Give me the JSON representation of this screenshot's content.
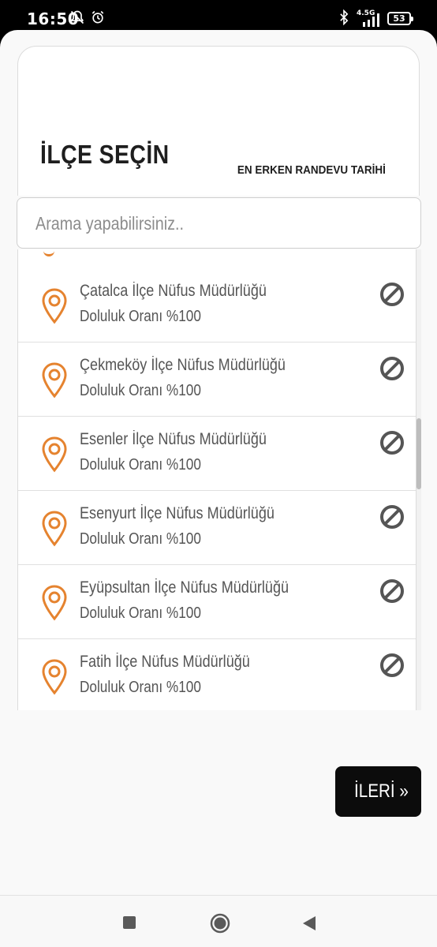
{
  "status_bar": {
    "time": "16:50",
    "network": "4.5G",
    "battery": "53",
    "icons": [
      "notifications-off-icon",
      "alarm-icon",
      "bluetooth-icon",
      "signal-icon",
      "battery-icon"
    ]
  },
  "header": {
    "title": "İLÇE SEÇİN",
    "earliest_label": "EN ERKEN RANDEVU TARİHİ"
  },
  "search": {
    "placeholder": "Arama yapabilirsiniz.."
  },
  "offices": [
    {
      "name": "Çatalca İlçe Nüfus Müdürlüğü",
      "occupancy": "Doluluk Oranı %100",
      "icon": "location-pin-icon",
      "status_icon": "unavailable-icon"
    },
    {
      "name": "Çekmeköy İlçe Nüfus Müdürlüğü",
      "occupancy": "Doluluk Oranı %100",
      "icon": "location-pin-icon",
      "status_icon": "unavailable-icon"
    },
    {
      "name": "Esenler İlçe Nüfus Müdürlüğü",
      "occupancy": "Doluluk Oranı %100",
      "icon": "location-pin-icon",
      "status_icon": "unavailable-icon"
    },
    {
      "name": "Esenyurt İlçe Nüfus Müdürlüğü",
      "occupancy": "Doluluk Oranı %100",
      "icon": "location-pin-icon",
      "status_icon": "unavailable-icon"
    },
    {
      "name": "Eyüpsultan İlçe Nüfus Müdürlüğü",
      "occupancy": "Doluluk Oranı %100",
      "icon": "location-pin-icon",
      "status_icon": "unavailable-icon"
    },
    {
      "name": "Fatih İlçe Nüfus Müdürlüğü",
      "occupancy": "Doluluk Oranı %100",
      "icon": "location-pin-icon",
      "status_icon": "unavailable-icon"
    }
  ],
  "next_button": {
    "label": "İLERİ »"
  },
  "colors": {
    "accent_pin": "#e5832f",
    "button_bg": "#0c0c0c",
    "status_icon": "#555555"
  }
}
